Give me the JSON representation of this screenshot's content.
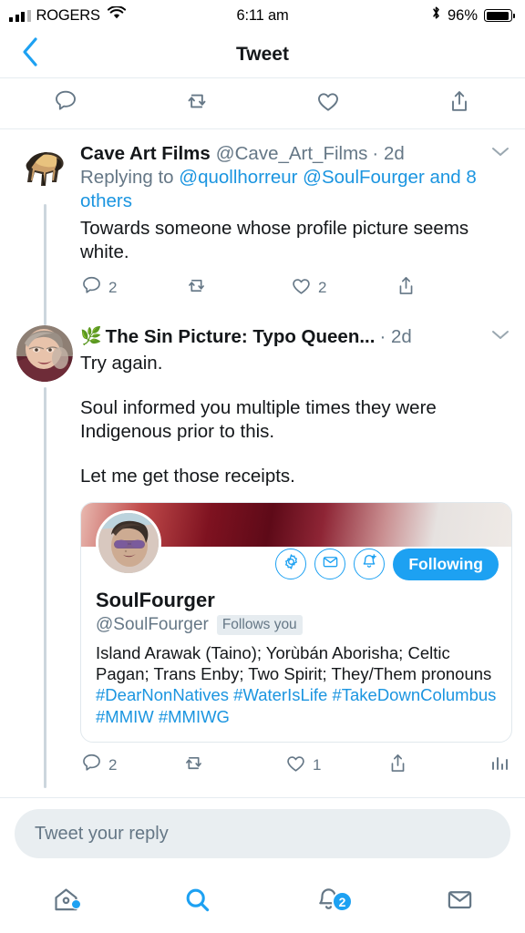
{
  "status_bar": {
    "carrier": "ROGERS",
    "time": "6:11 am",
    "battery_percent": "96%",
    "signal_icon": "cellular-signal-icon",
    "wifi_icon": "wifi-icon",
    "bluetooth_icon": "bluetooth-icon",
    "battery_icon": "battery-icon"
  },
  "navbar": {
    "back_icon": "chevron-left-icon",
    "title": "Tweet"
  },
  "top_actions": [
    {
      "name": "reply-icon",
      "label": ""
    },
    {
      "name": "retweet-icon",
      "label": ""
    },
    {
      "name": "like-icon",
      "label": ""
    },
    {
      "name": "share-icon",
      "label": ""
    }
  ],
  "tweets": [
    {
      "display_name": "Cave Art Films",
      "handle": "@Cave_Art_Films",
      "timestamp": "· 2d",
      "avatar_name": "cave-art-avatar",
      "replying_prefix": "Replying to ",
      "replying_mentions": "@quollhorreur @SoulFourger",
      "replying_suffix": "and 8 others",
      "text": "Towards someone whose profile picture seems white.",
      "reply_count": "2",
      "retweet_count": "",
      "like_count": "2"
    },
    {
      "display_name": "The Sin Picture: Typo Queen...",
      "emoji": "🌿",
      "timestamp": "· 2d",
      "avatar_name": "typo-queen-avatar",
      "text_line1": "Try again.",
      "paragraph1": "Soul informed you multiple times they were Indigenous prior to this.",
      "paragraph2": "Let me get those receipts.",
      "reply_count": "2",
      "retweet_count": "",
      "like_count": "1",
      "analytics_icon": "analytics-bars-icon"
    }
  ],
  "profile_card": {
    "name": "SoulFourger",
    "handle": "@SoulFourger",
    "follows_you_badge": "Follows you",
    "bio_text": "Island Arawak (Taino); Yorùbán Aborisha; Celtic Pagan; Trans Enby; Two Spirit; They/Them pronouns ",
    "bio_tags": "#DearNonNatives #WaterIsLife #TakeDownColumbus #MMIW #MMIWG",
    "follow_button_label": "Following",
    "gear_icon": "gear-icon",
    "message_icon": "envelope-icon",
    "notify_icon": "bell-plus-icon",
    "avatar_name": "soulfourger-avatar",
    "banner_name": "profile-banner"
  },
  "composer": {
    "placeholder": "Tweet your reply"
  },
  "tabbar": [
    {
      "name": "tab-home",
      "icon": "home-icon",
      "badge": "",
      "has_dot": true
    },
    {
      "name": "tab-search",
      "icon": "search-icon",
      "badge": "",
      "has_dot": false
    },
    {
      "name": "tab-notifications",
      "icon": "bell-icon",
      "badge": "2",
      "has_dot": false
    },
    {
      "name": "tab-messages",
      "icon": "envelope-icon",
      "badge": "",
      "has_dot": false
    }
  ],
  "colors": {
    "twitter_blue": "#1da1f2",
    "link_blue": "#1b95e0",
    "muted_gray": "#657786",
    "border": "#e6ecf0",
    "composer_bg": "#e9eef1"
  }
}
